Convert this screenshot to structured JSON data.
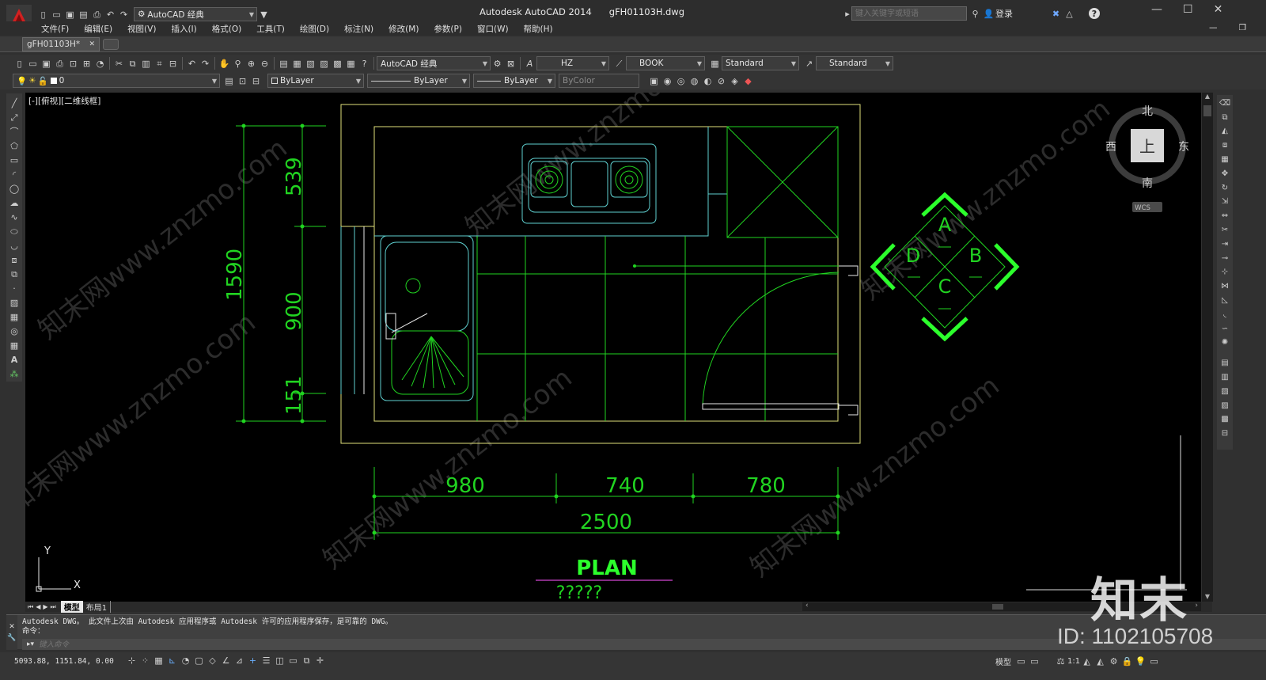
{
  "title_bar": {
    "workspace": "AutoCAD 经典",
    "app_title": "Autodesk AutoCAD 2014",
    "file_name": "gFH01103H.dwg",
    "search_placeholder": "键入关键字或短语",
    "login_label": "登录",
    "help_icon": "?"
  },
  "menu": [
    "文件(F)",
    "编辑(E)",
    "视图(V)",
    "插入(I)",
    "格式(O)",
    "工具(T)",
    "绘图(D)",
    "标注(N)",
    "修改(M)",
    "参数(P)",
    "窗口(W)",
    "帮助(H)"
  ],
  "doc_tab": {
    "label": "gFH01103H*"
  },
  "toolbar": {
    "workspace_combo": "AutoCAD 经典",
    "text_style": "HZ",
    "dim_style": "BOOK",
    "table_style": "Standard",
    "multileader_style": "Standard"
  },
  "layer_bar": {
    "layer": "0",
    "color": "ByLayer",
    "linetype": "ByLayer",
    "lineweight": "ByLayer",
    "plotstyle": "ByColor"
  },
  "viewport_label": "[-][俯视][二维线框]",
  "drawing": {
    "dims_vertical": [
      "539",
      "900",
      "151",
      "1590"
    ],
    "dims_horizontal": [
      "980",
      "740",
      "780",
      "2500"
    ],
    "plan_title": "PLAN",
    "plan_subtitle": "?????",
    "section_markers": [
      "A",
      "B",
      "C",
      "D"
    ],
    "ucs_y": "Y",
    "ucs_x": "X"
  },
  "viewcube": {
    "north": "北",
    "south": "南",
    "east": "东",
    "west": "西",
    "top": "上",
    "wcs": "WCS"
  },
  "layout_tabs": [
    "模型",
    "布局1"
  ],
  "command_history": [
    "Autodesk DWG。  此文件上次由 Autodesk 应用程序或 Autodesk 许可的应用程序保存，是可靠的 DWG。",
    "命令："
  ],
  "command_placeholder": "键入命令",
  "status": {
    "coords": "5093.88, 1151.84, 0.00",
    "model_label": "模型",
    "annotation_scale": "1:1"
  },
  "watermark": {
    "logo_text": "知末",
    "id_text": "ID: 1102105708",
    "site_text": "知末网www.znzmo.com"
  },
  "colors": {
    "canvas": "#000000",
    "dim_green": "#21d421",
    "frame_yellow": "#e0e07a",
    "cyan": "#5fd0d0",
    "marker_green": "#2cff2c",
    "magenta": "#b03ab0"
  }
}
